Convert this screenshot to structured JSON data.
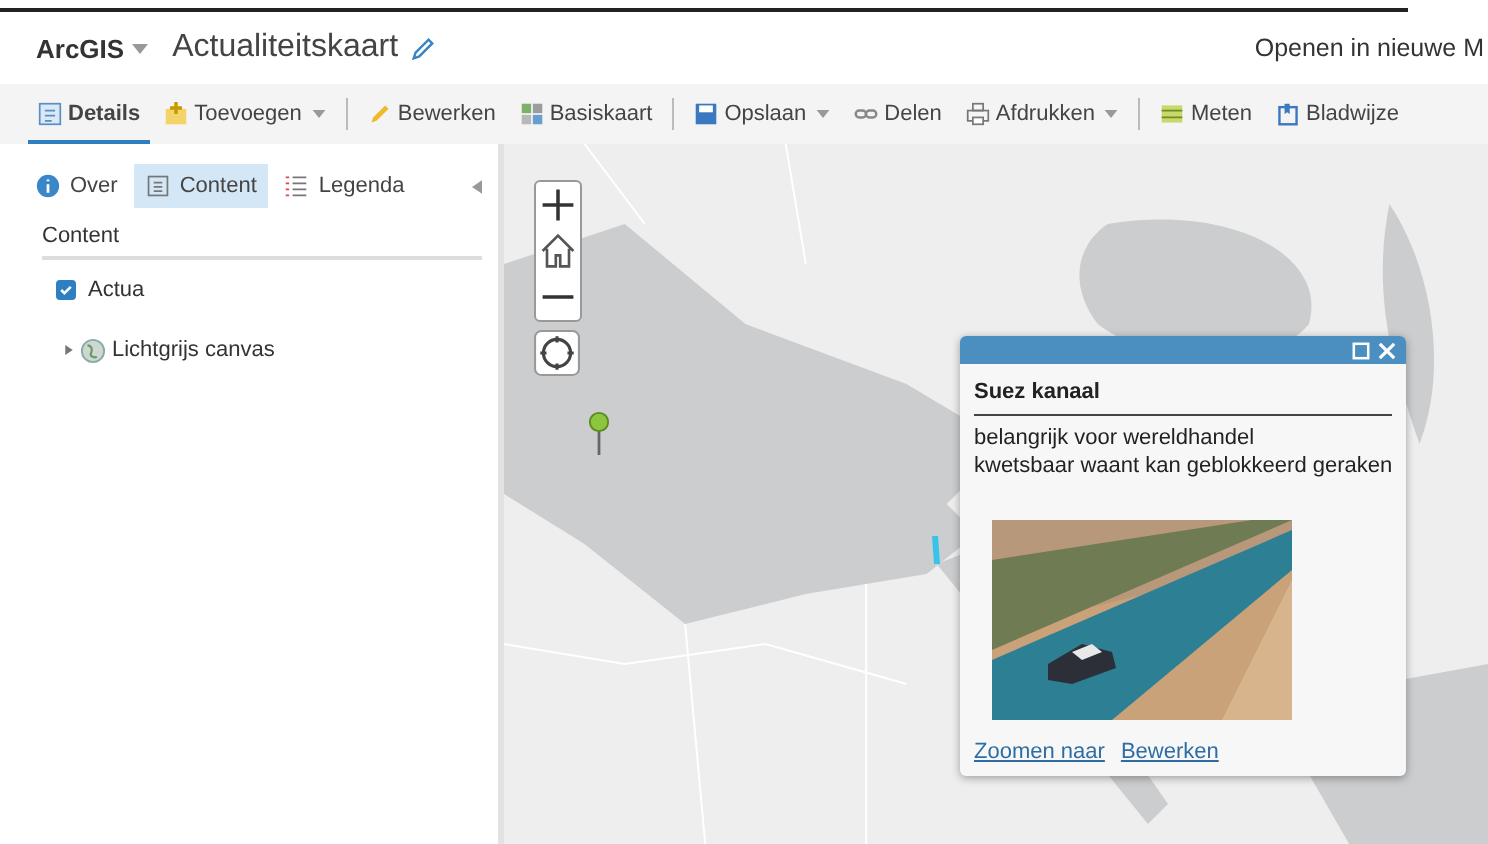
{
  "header": {
    "app": "ArcGIS",
    "title": "Actualiteitskaart",
    "open_link": "Openen in nieuwe M"
  },
  "toolbar": [
    {
      "label": "Details",
      "dropdown": false,
      "selected": true,
      "separator_after": false
    },
    {
      "label": "Toevoegen",
      "dropdown": true,
      "selected": false,
      "separator_after": true
    },
    {
      "label": "Bewerken",
      "dropdown": false,
      "selected": false,
      "separator_after": false
    },
    {
      "label": "Basiskaart",
      "dropdown": false,
      "selected": false,
      "separator_after": true
    },
    {
      "label": "Opslaan",
      "dropdown": true,
      "selected": false,
      "separator_after": false
    },
    {
      "label": "Delen",
      "dropdown": false,
      "selected": false,
      "separator_after": false
    },
    {
      "label": "Afdrukken",
      "dropdown": true,
      "selected": false,
      "separator_after": true
    },
    {
      "label": "Meten",
      "dropdown": false,
      "selected": false,
      "separator_after": false
    },
    {
      "label": "Bladwijze",
      "dropdown": false,
      "selected": false,
      "separator_after": false
    }
  ],
  "sidebar": {
    "tabs": [
      {
        "label": "Over",
        "selected": false
      },
      {
        "label": "Content",
        "selected": true
      },
      {
        "label": "Legenda",
        "selected": false
      }
    ],
    "heading": "Content",
    "layers": [
      {
        "kind": "checkbox",
        "label": "Actua",
        "checked": true
      },
      {
        "kind": "group",
        "label": "Lichtgrijs canvas",
        "expanded": false
      }
    ]
  },
  "popup": {
    "title": "Suez kanaal",
    "lines": [
      "belangrijk voor wereldhandel",
      "kwetsbaar waant kan geblokkeerd geraken"
    ],
    "image": {
      "kind": "picture"
    },
    "links": [
      "Zoomen naar",
      "Bewerken"
    ]
  }
}
